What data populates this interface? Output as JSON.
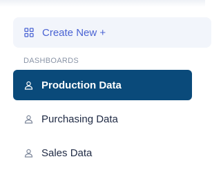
{
  "create_button": {
    "label": "Create New +",
    "icon": "grid-icon"
  },
  "section": {
    "header": "DASHBOARDS"
  },
  "nav": {
    "items": [
      {
        "label": "Production Data",
        "icon": "user-icon",
        "active": true
      },
      {
        "label": "Purchasing Data",
        "icon": "user-icon",
        "active": false
      },
      {
        "label": "Sales Data",
        "icon": "user-icon",
        "active": false
      }
    ]
  },
  "colors": {
    "accent": "#4a63d3",
    "active_bg": "#0a4a7a",
    "create_bg": "#f2f5fb",
    "muted": "#8a94a6",
    "text": "#1f2a44"
  }
}
